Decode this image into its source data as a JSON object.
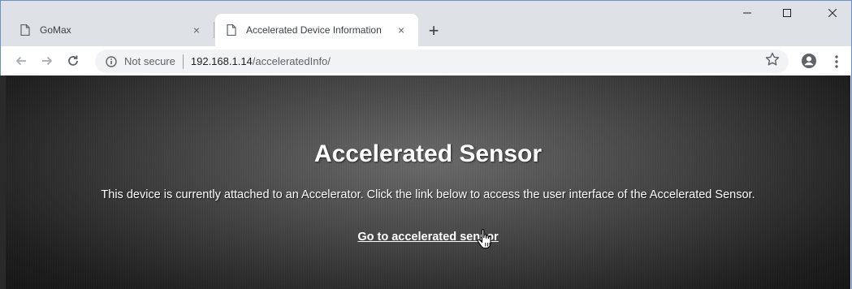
{
  "browser": {
    "tabs": [
      {
        "title": "GoMax",
        "active": false
      },
      {
        "title": "Accelerated Device Information",
        "active": true
      }
    ],
    "new_tab_label": "+",
    "close_glyph": "×",
    "window_controls": {
      "minimize": "minimize-icon",
      "maximize": "maximize-icon",
      "close": "close-icon"
    },
    "address_bar": {
      "security_label": "Not secure",
      "url_host": "192.168.1.14",
      "url_path": "/acceleratedInfo/"
    },
    "colors": {
      "tab_strip": "#dee1e6",
      "active_tab": "#ffffff",
      "omnibox": "#f1f3f4"
    }
  },
  "page": {
    "headline": "Accelerated Sensor",
    "description": "This device is currently attached to an Accelerator. Click the link below to access the user interface of the Accelerated Sensor.",
    "link_text": "Go to accelerated sensor",
    "colors": {
      "text": "#ffffff",
      "background_center": "#6a6a6a",
      "background_edge": "#121212"
    }
  }
}
